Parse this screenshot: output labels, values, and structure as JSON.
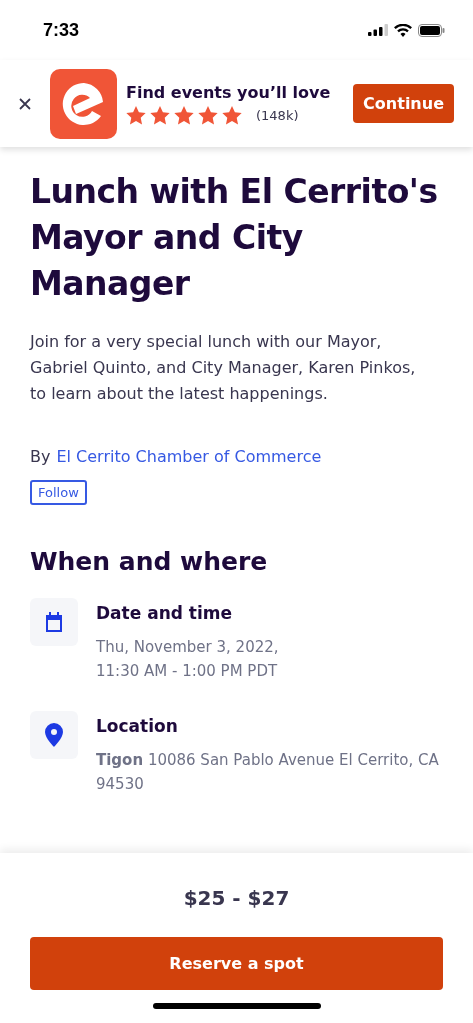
{
  "status_bar": {
    "time": "7:33"
  },
  "app_banner": {
    "title": "Find events you’ll love",
    "stars": 5,
    "review_count": "(148k)",
    "button": "Continue"
  },
  "event": {
    "title": "Lunch with El Cerrito's Mayor and City Manager",
    "description": "Join for a very special lunch with our Mayor, Gabriel Quinto, and City Manager, Karen Pinkos, to learn about the latest happenings.",
    "organizer_prefix": "By",
    "organizer": "El Cerrito Chamber of Commerce",
    "follow_button": "Follow"
  },
  "when_and_where": {
    "heading": "When and where",
    "items": [
      {
        "kind": "calendar",
        "label": "Date and time",
        "lines": [
          "Thu, November 3, 2022,",
          "11:30 AM - 1:00 PM PDT"
        ]
      },
      {
        "kind": "location",
        "label": "Location",
        "lines": [
          "**Tigon** 10086 San Pablo Avenue El Cerrito, CA 94530"
        ]
      }
    ]
  },
  "footer": {
    "price": "$25 - $27",
    "button": "Reserve a spot"
  }
}
